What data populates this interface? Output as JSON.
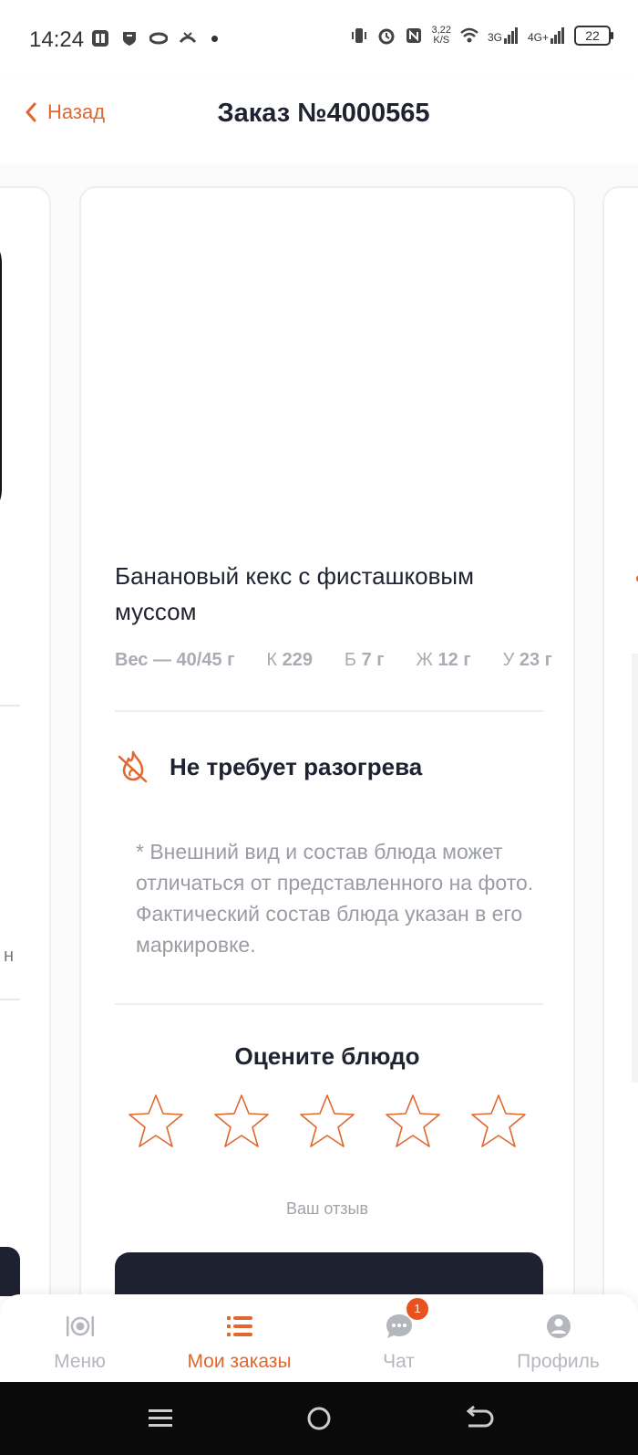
{
  "status_bar": {
    "time": "14:24",
    "net_speed_top": "3,22",
    "net_speed_bottom": "K/S",
    "signal1": "3G",
    "signal2": "4G+",
    "battery": "22"
  },
  "header": {
    "back_label": "Назад",
    "title": "Заказ №4000565"
  },
  "dish": {
    "name": "Банановый кекс с фисташковым муссом",
    "weight_label": "Вес — 40/45 г",
    "kcal_prefix": "К",
    "kcal_value": "229",
    "protein_prefix": "Б",
    "protein_value": "7 г",
    "fat_prefix": "Ж",
    "fat_value": "12 г",
    "carbs_prefix": "У",
    "carbs_value": "23 г",
    "heating_note": "Не требует разогрева",
    "disclaimer": "* Внешний вид и состав блюда может отличаться от представленного на фото. Фактический состав блюда указан в его маркировке."
  },
  "rating": {
    "title": "Оцените блюдо",
    "stars_total": 5,
    "stars_selected": 0,
    "review_placeholder": "Ваш отзыв"
  },
  "prev_card": {
    "text_fragment": "н"
  },
  "bottom_nav": {
    "items": [
      {
        "label": "Меню",
        "icon": "plate-cutlery-icon"
      },
      {
        "label": "Мои заказы",
        "icon": "list-icon"
      },
      {
        "label": "Чат",
        "icon": "chat-icon",
        "badge": "1"
      },
      {
        "label": "Профиль",
        "icon": "profile-icon"
      }
    ],
    "active_index": 1
  },
  "colors": {
    "accent": "#e0672d",
    "dark": "#1e2230",
    "badge": "#e8521f"
  }
}
